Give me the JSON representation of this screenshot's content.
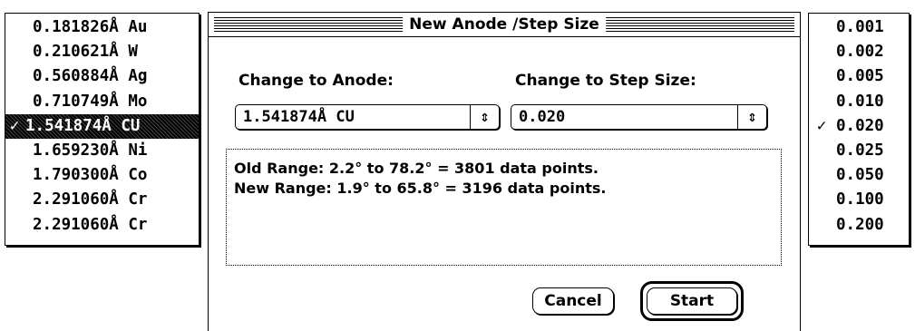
{
  "anode_menu": {
    "items": [
      {
        "label": "0.181826Å Au",
        "checked": false
      },
      {
        "label": "0.210621Å W",
        "checked": false
      },
      {
        "label": "0.560884Å Ag",
        "checked": false
      },
      {
        "label": "0.710749Å Mo",
        "checked": false
      },
      {
        "label": "1.541874Å CU",
        "checked": true
      },
      {
        "label": "1.659230Å Ni",
        "checked": false
      },
      {
        "label": "1.790300Å Co",
        "checked": false
      },
      {
        "label": "2.291060Å Cr",
        "checked": false
      },
      {
        "label": "2.291060Å Cr",
        "checked": false
      }
    ],
    "check_mark": "✓"
  },
  "dialog": {
    "title": "New Anode /Step Size",
    "anode_label": "Change to Anode:",
    "step_label": "Change to Step Size:",
    "anode_value": "1.541874Å CU",
    "step_value": "0.020",
    "popup_arrow_icon": "⇕",
    "old_range": "Old Range: 2.2° to 78.2° = 3801 data points.",
    "new_range": "New Range: 1.9° to 65.8° = 3196 data points.",
    "cancel_label": "Cancel",
    "start_label": "Start"
  },
  "step_menu": {
    "items": [
      {
        "label": "0.001",
        "checked": false
      },
      {
        "label": "0.002",
        "checked": false
      },
      {
        "label": "0.005",
        "checked": false
      },
      {
        "label": "0.010",
        "checked": false
      },
      {
        "label": "0.020",
        "checked": true
      },
      {
        "label": "0.025",
        "checked": false
      },
      {
        "label": "0.050",
        "checked": false
      },
      {
        "label": "0.100",
        "checked": false
      },
      {
        "label": "0.200",
        "checked": false
      }
    ],
    "check_mark": "✓"
  }
}
